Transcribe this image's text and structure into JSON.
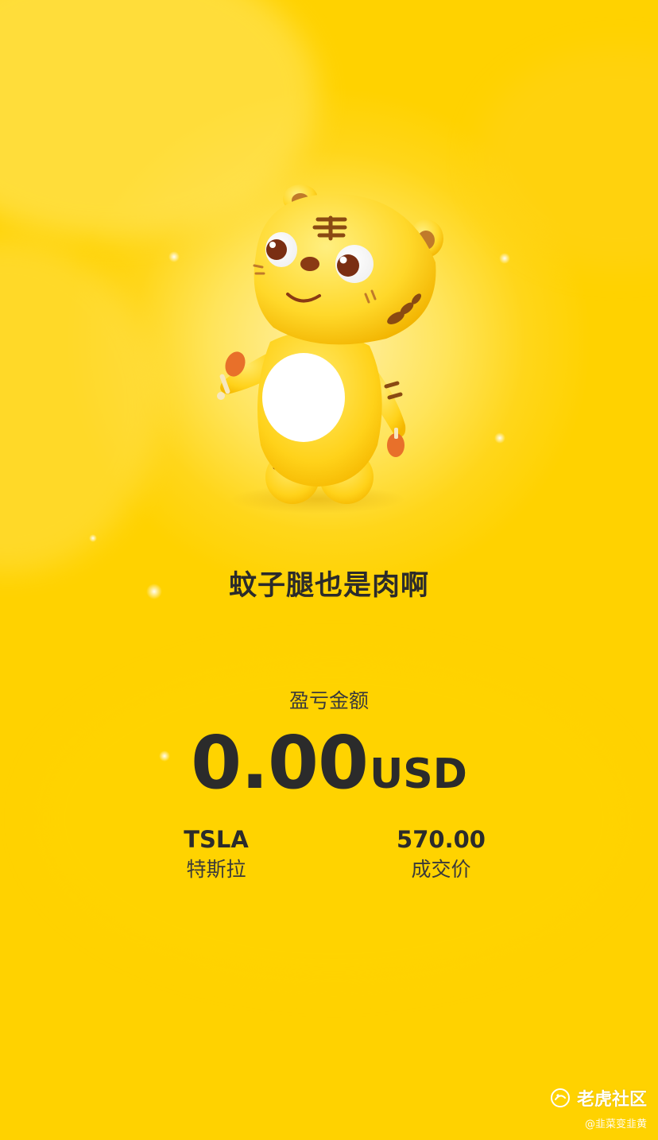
{
  "slogan": "蚊子腿也是肉啊",
  "pnl": {
    "label": "盈亏金额",
    "value": "0.00",
    "currency": "USD"
  },
  "stock": {
    "symbol": "TSLA",
    "name": "特斯拉"
  },
  "trade": {
    "price": "570.00",
    "price_label": "成交价"
  },
  "watermark": {
    "community": "老虎社区",
    "user": "@韭菜变韭黄",
    "logo_icon": "tiger-logo-icon"
  },
  "colors": {
    "background": "#ffd600",
    "text": "#2b2b2b"
  }
}
